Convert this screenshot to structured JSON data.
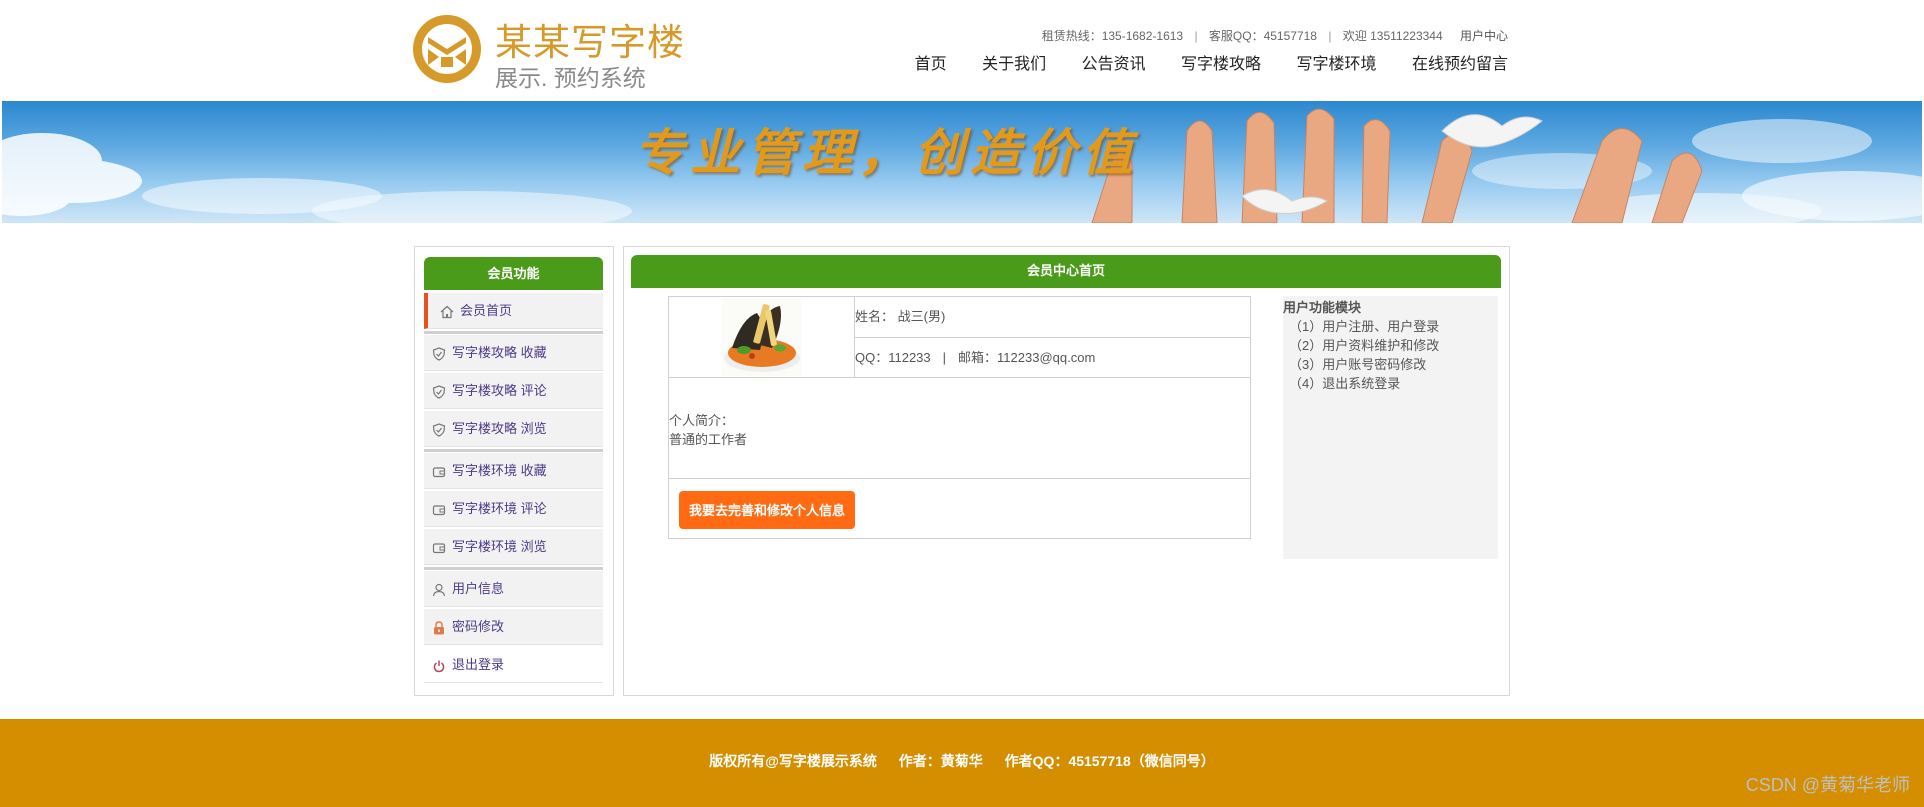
{
  "brand": {
    "title": "某某写字楼",
    "subtitle": "展示. 预约系统",
    "logo_icon": "brand-logo-icon",
    "accent": "#d69a2b"
  },
  "topbar": {
    "hotline": "租赁热线：135-1682-1613",
    "qq": "客服QQ：45157718",
    "welcome": "欢迎 13511223344",
    "separator": "|",
    "user_center": "用户中心"
  },
  "nav": [
    "首页",
    "关于我们",
    "公告资讯",
    "写字楼攻略",
    "写字楼环境",
    "在线预约留言"
  ],
  "banner": {
    "slogan": "专业管理，创造价值"
  },
  "sidebar": {
    "title": "会员功能",
    "header_color": "#4a9b1a",
    "items": [
      {
        "label": "会员首页",
        "icon": "home-icon",
        "active": true
      },
      {
        "label": "写字楼攻略 收藏",
        "icon": "shield-icon"
      },
      {
        "label": "写字楼攻略 评论",
        "icon": "shield-icon"
      },
      {
        "label": "写字楼攻略 浏览",
        "icon": "shield-icon"
      },
      {
        "label": "写字楼环境 收藏",
        "icon": "wallet-icon"
      },
      {
        "label": "写字楼环境 评论",
        "icon": "wallet-icon"
      },
      {
        "label": "写字楼环境 浏览",
        "icon": "wallet-icon"
      },
      {
        "label": "用户信息",
        "icon": "user-icon"
      },
      {
        "label": "密码修改",
        "icon": "lock-icon"
      },
      {
        "label": "退出登录",
        "icon": "power-icon"
      }
    ]
  },
  "main": {
    "title": "会员中心首页",
    "profile": {
      "avatar_icon": "food-avatar-image",
      "name_line": "姓名： 战三(男)",
      "qq": "QQ：112233",
      "pipe": "|",
      "email": "邮箱：112233@qq.com",
      "intro_label": "个人简介：",
      "intro_text": "普通的工作者"
    },
    "edit_button": "我要去完善和修改个人信息",
    "button_color": "#ff6a12",
    "module": {
      "title": "用户功能模块",
      "items": [
        "（1）用户注册、用户登录",
        "（2）用户资料维护和修改",
        "（3）用户账号密码修改",
        "（4）退出系统登录"
      ]
    }
  },
  "footer": {
    "copyright": "版权所有@写字楼展示系统",
    "author": "作者：黄菊华",
    "author_qq": "作者QQ：45157718（微信同号）",
    "color": "#d48e00"
  },
  "watermark": "CSDN @黄菊华老师"
}
